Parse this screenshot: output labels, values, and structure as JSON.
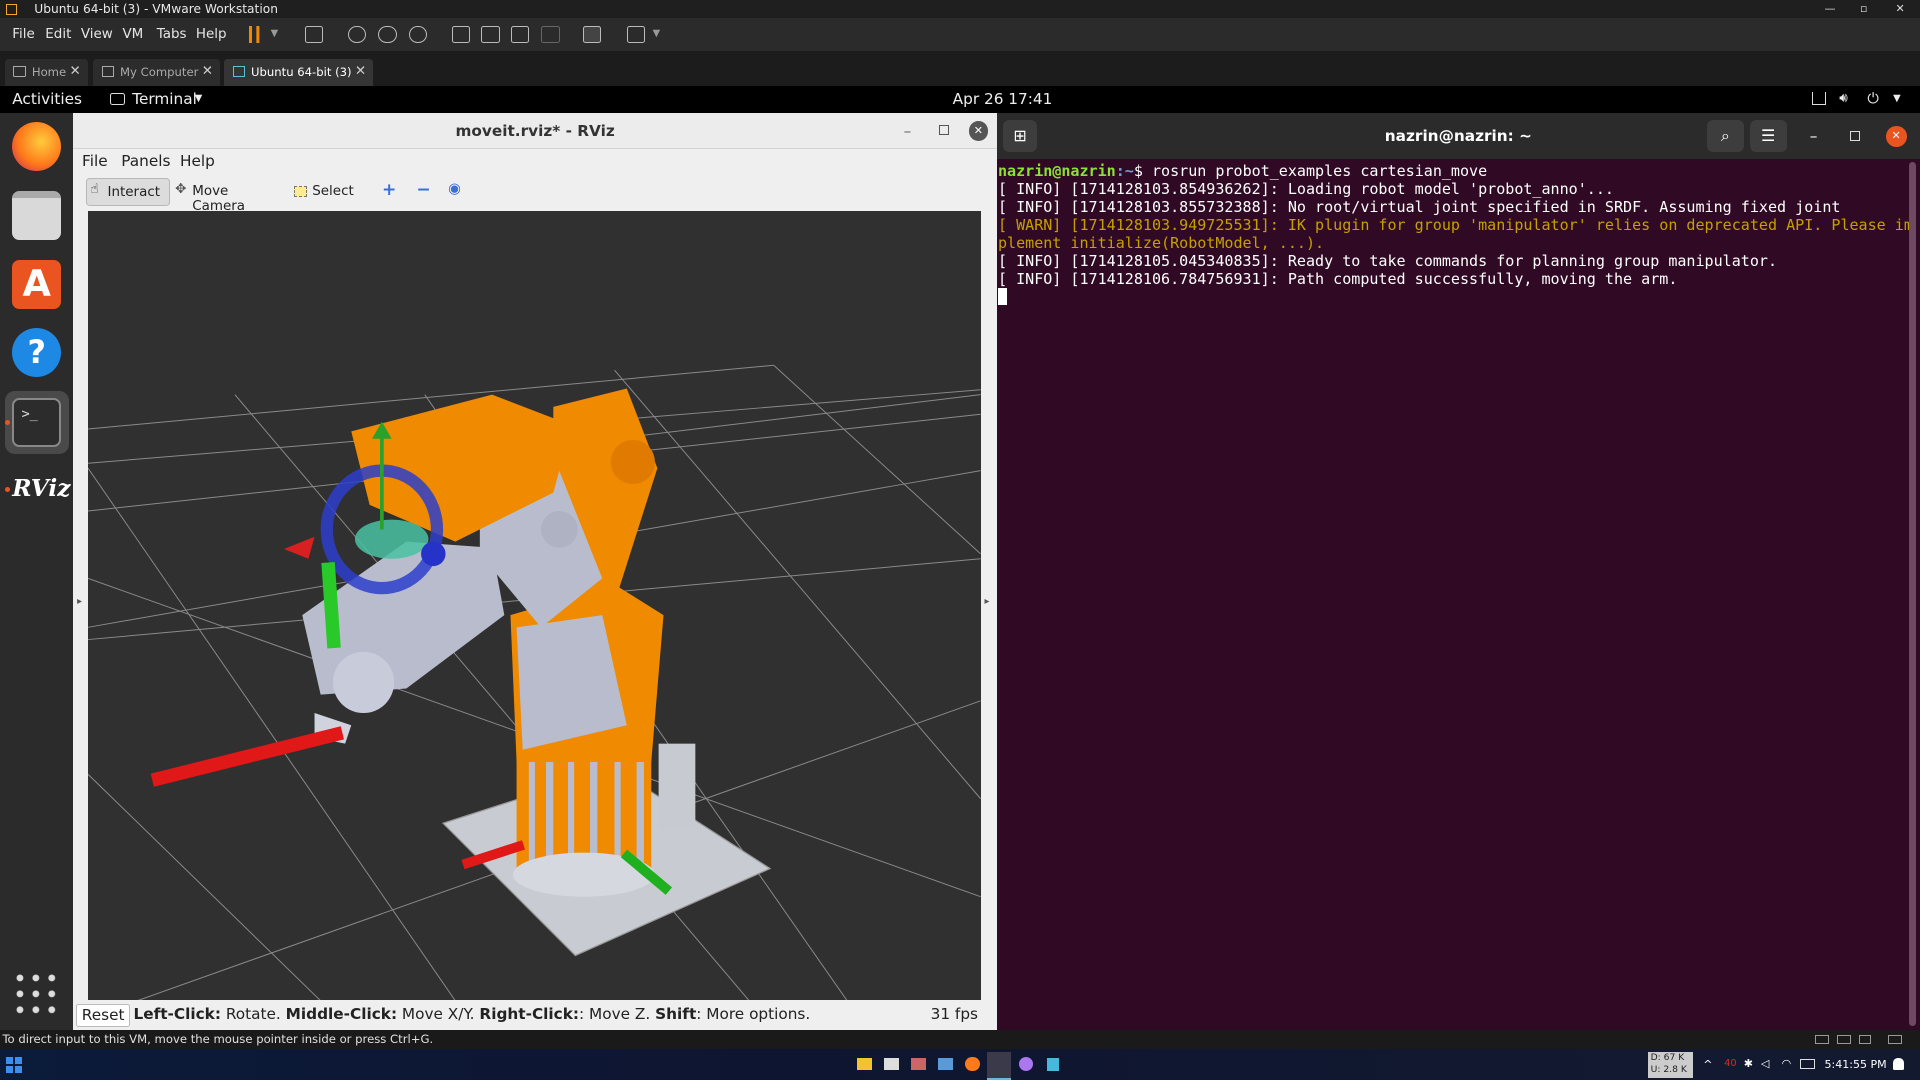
{
  "vmware": {
    "window_title": "Ubuntu 64-bit (3) - VMware Workstation",
    "menu": [
      "File",
      "Edit",
      "View",
      "VM",
      "Tabs",
      "Help"
    ],
    "tabs": [
      {
        "label": "Home"
      },
      {
        "label": "My Computer"
      },
      {
        "label": "Ubuntu 64-bit (3)",
        "active": true
      }
    ],
    "status_hint": "To direct input to this VM, move the mouse pointer inside or press Ctrl+G."
  },
  "gnome": {
    "activities": "Activities",
    "app_menu": "Terminal",
    "clock": "Apr 26  17:41"
  },
  "dock": {
    "items": [
      "firefox-icon",
      "files-icon",
      "software-icon",
      "help-icon",
      "terminal-icon",
      "rviz-icon",
      "show-apps-icon"
    ],
    "rviz_logo": "RViz"
  },
  "rviz": {
    "title": "moveit.rviz* - RViz",
    "menu": [
      "File",
      "Panels",
      "Help"
    ],
    "tools": {
      "interact": "Interact",
      "move_camera": "Move Camera",
      "select": "Select"
    },
    "status": {
      "reset": "Reset",
      "lc": "Left-Click:",
      "lc_t": " Rotate. ",
      "mc": "Middle-Click:",
      "mc_t": " Move X/Y. ",
      "rc": "Right-Click:",
      "rc_t": ": Move Z. ",
      "sh": "Shift",
      "sh_t": ": More options.",
      "fps": "31 fps"
    }
  },
  "terminal": {
    "title": "nazrin@nazrin: ~",
    "prompt_user": "nazrin@nazrin",
    "prompt_path": ":~",
    "prompt_sym": "$ ",
    "command": "rosrun probot_examples cartesian_move",
    "lines": [
      {
        "type": "info",
        "text": "[ INFO] [1714128103.854936262]: Loading robot model 'probot_anno'..."
      },
      {
        "type": "info",
        "text": "[ INFO] [1714128103.855732388]: No root/virtual joint specified in SRDF. Assuming fixed joint"
      },
      {
        "type": "warn",
        "text": "[ WARN] [1714128103.949725531]: IK plugin for group 'manipulator' relies on deprecated API. Please im"
      },
      {
        "type": "warn",
        "text": "plement initialize(RobotModel, ...)."
      },
      {
        "type": "info",
        "text": "[ INFO] [1714128105.045340835]: Ready to take commands for planning group manipulator."
      },
      {
        "type": "info",
        "text": "[ INFO] [1714128106.784756931]: Path computed successfully, moving the arm."
      }
    ]
  },
  "taskbar": {
    "net_down": "D: 67 K",
    "net_up": "U: 2.8 K",
    "time": "5:41:55 PM",
    "temp": "40"
  },
  "colors": {
    "terminal_bg": "#300a24",
    "prompt_green": "#8ae234",
    "prompt_blue": "#729fcf",
    "warn": "#c4a000",
    "robot_orange": "#f08a00",
    "robot_silver": "#b8bccc"
  }
}
